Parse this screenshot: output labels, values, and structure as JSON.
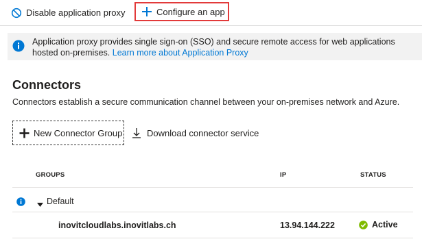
{
  "toolbar": {
    "disable_label": "Disable application proxy",
    "configure_label": "Configure an app"
  },
  "info_banner": {
    "text": "Application proxy provides single sign-on (SSO) and secure remote access for web applications hosted on-premises.",
    "link_label": "Learn more about Application Proxy"
  },
  "connectors": {
    "title": "Connectors",
    "description": "Connectors establish a secure communication channel between your on-premises network and Azure.",
    "new_group_label": "New Connector Group",
    "download_label": "Download connector service",
    "table": {
      "headers": {
        "groups": "GROUPS",
        "ip": "IP",
        "status": "STATUS"
      },
      "group": {
        "name": "Default",
        "connectors": [
          {
            "name": "inovitcloudlabs.inovitlabs.ch",
            "ip": "13.94.144.222",
            "status": "Active"
          }
        ]
      }
    }
  },
  "colors": {
    "accent": "#0078d4",
    "highlight_border": "#e23a3a",
    "status_active": "#7fba00",
    "info_bg": "#f2f2f2"
  },
  "icons": {
    "disable": "block-icon",
    "configure": "plus-icon",
    "info": "info-icon",
    "new_group": "plus-icon",
    "download": "download-icon",
    "caret": "caret-down-icon",
    "status": "check-circle-icon"
  }
}
